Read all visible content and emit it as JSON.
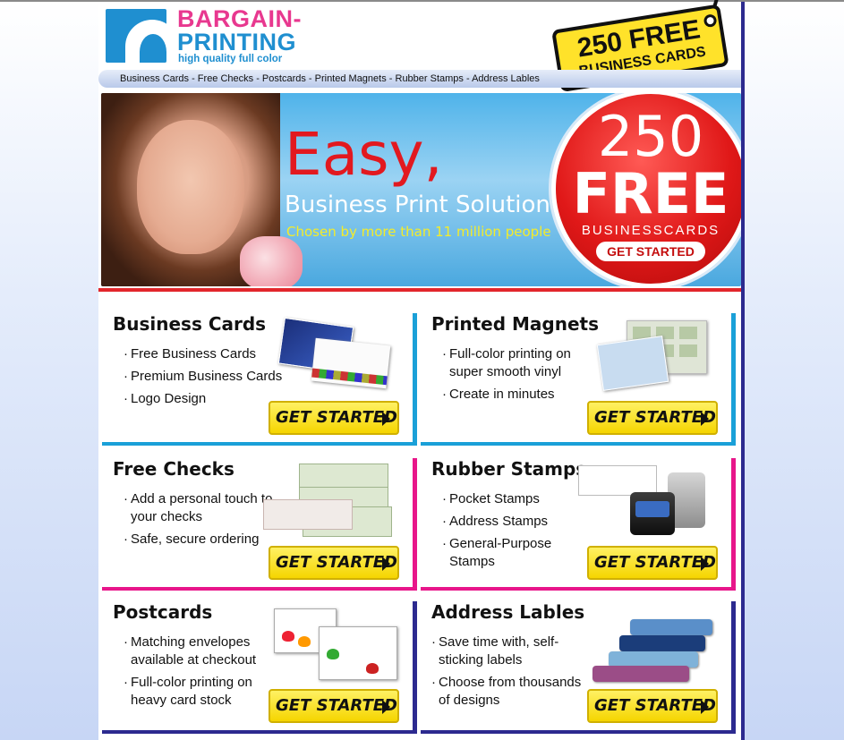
{
  "brand": {
    "line1": "BARGAIN-",
    "line2": "PRINTING",
    "tagline": "high quality full color",
    "colors": {
      "pink": "#e8388f",
      "blue": "#1f8fd0"
    }
  },
  "promo_tag": {
    "line1": "250 FREE",
    "line2": "BUSINESS CARDS"
  },
  "nav": {
    "text": "Business Cards - Free Checks - Postcards - Printed Magnets - Rubber Stamps - Address Lables"
  },
  "hero": {
    "headline": "Easy,",
    "subtitle": "Business Print Solution",
    "subtitle2": "Chosen by more than 11 million people",
    "badge": {
      "count": "250",
      "free": "FREE",
      "label": "BUSINESSCARDS",
      "button": "GET STARTED"
    }
  },
  "products": [
    {
      "title": "Business Cards",
      "items": [
        "Free Business Cards",
        "Premium Business Cards",
        "Logo Design"
      ],
      "button": "GET STARTED",
      "accent": "#1aa0d8"
    },
    {
      "title": "Printed Magnets",
      "items": [
        "Full-color printing on super smooth vinyl",
        "Create in minutes"
      ],
      "button": "GET STARTED",
      "accent": "#1aa0d8"
    },
    {
      "title": "Free Checks",
      "items": [
        "Add a personal touch to your checks",
        "Safe, secure ordering"
      ],
      "button": "GET STARTED",
      "accent": "#e8168a"
    },
    {
      "title": "Rubber Stamps",
      "items": [
        "Pocket Stamps",
        "Address Stamps",
        "General-Purpose Stamps"
      ],
      "button": "GET STARTED",
      "accent": "#e8168a"
    },
    {
      "title": "Postcards",
      "items": [
        "Matching envelopes available at checkout",
        "Full-color printing on heavy card stock"
      ],
      "button": "GET STARTED",
      "accent": "#2c2a8f"
    },
    {
      "title": "Address Lables",
      "items": [
        "Save time with, self-sticking labels",
        "Choose from thousands of designs"
      ],
      "button": "GET STARTED",
      "accent": "#2c2a8f"
    }
  ]
}
